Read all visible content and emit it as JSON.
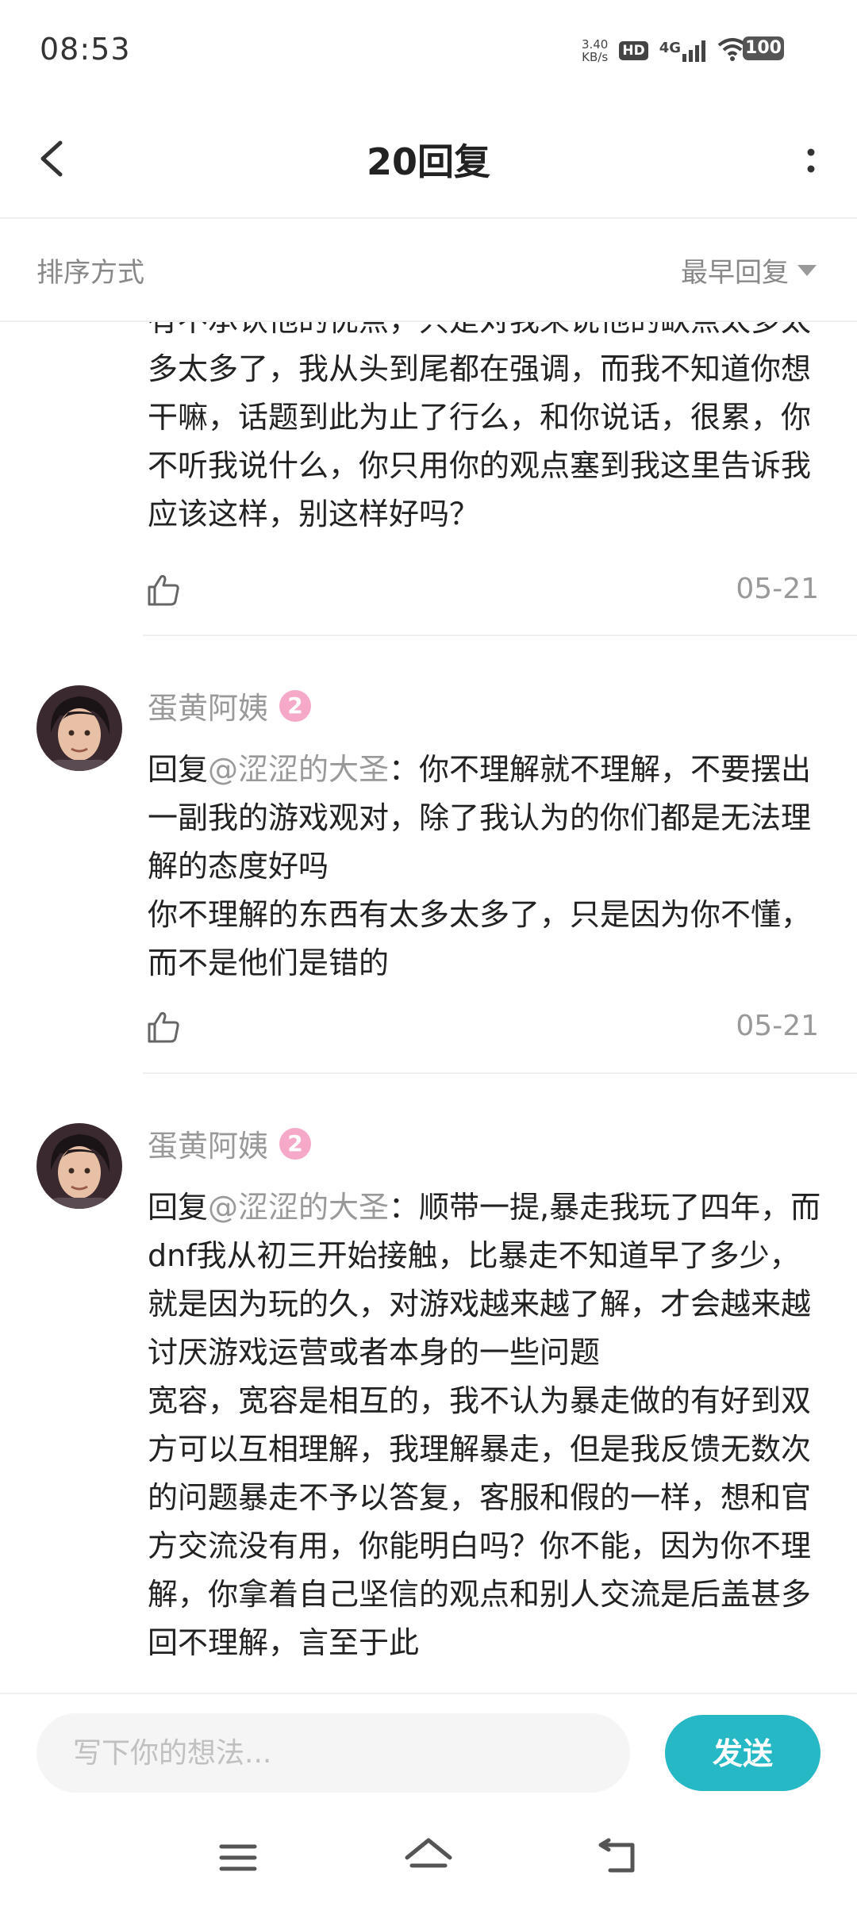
{
  "status_bar": {
    "time": "08:53",
    "net_speed_value": "3.40",
    "net_speed_unit": "KB/s",
    "hd_label": "HD",
    "network_type": "4G",
    "battery": "100"
  },
  "header": {
    "title": "20回复"
  },
  "sort": {
    "label": "排序方式",
    "selected": "最早回复"
  },
  "comments": [
    {
      "text": "有不承认他的优点，只是对我来说他的缺点太多太多太多了，我从头到尾都在强调，而我不知道你想干嘛，话题到此为止了行么，和你说话，很累，你不听我说什么，你只用你的观点塞到我这里告诉我应该这样，别这样好吗？",
      "date": "05-21"
    },
    {
      "author": "蛋黄阿姨",
      "level": "2",
      "reply_prefix": "回复",
      "mention": "@涩涩的大圣",
      "reply_colon": "：",
      "text_lines": [
        "你不理解就不理解，不要摆出一副我的游戏观对，除了我认为的你们都是无法理解的态度好吗",
        "你不理解的东西有太多太多了，只是因为你不懂，而不是他们是错的"
      ],
      "date": "05-21"
    },
    {
      "author": "蛋黄阿姨",
      "level": "2",
      "reply_prefix": "回复",
      "mention": "@涩涩的大圣",
      "reply_colon": "：",
      "text_lines": [
        "顺带一提,暴走我玩了四年，而dnf我从初三开始接触，比暴走不知道早了多少，就是因为玩的久，对游戏越来越了解，才会越来越讨厌游戏运营或者本身的一些问题",
        "宽容，宽容是相互的，我不认为暴走做的有好到双方可以互相理解，我理解暴走，但是我反馈无数次的问题暴走不予以答复，客服和假的一样，想和官方交流没有用，你能明白吗？你不能，因为你不理解，你拿着自己坚信的观点和别人交流是后盖甚多回不理解，言至于此"
      ]
    }
  ],
  "input": {
    "placeholder": "写下你的想法...",
    "send_label": "发送"
  },
  "colors": {
    "accent": "#27b8c5",
    "muted_text": "#999999",
    "level_badge": "#f6a8c8"
  },
  "icons": {
    "back": "chevron-left-icon",
    "more": "more-vertical-icon",
    "like": "thumbs-up-icon",
    "sort_arrow": "triangle-down-icon",
    "menu": "menu-icon",
    "home": "home-icon",
    "back_nav": "back-nav-icon"
  }
}
